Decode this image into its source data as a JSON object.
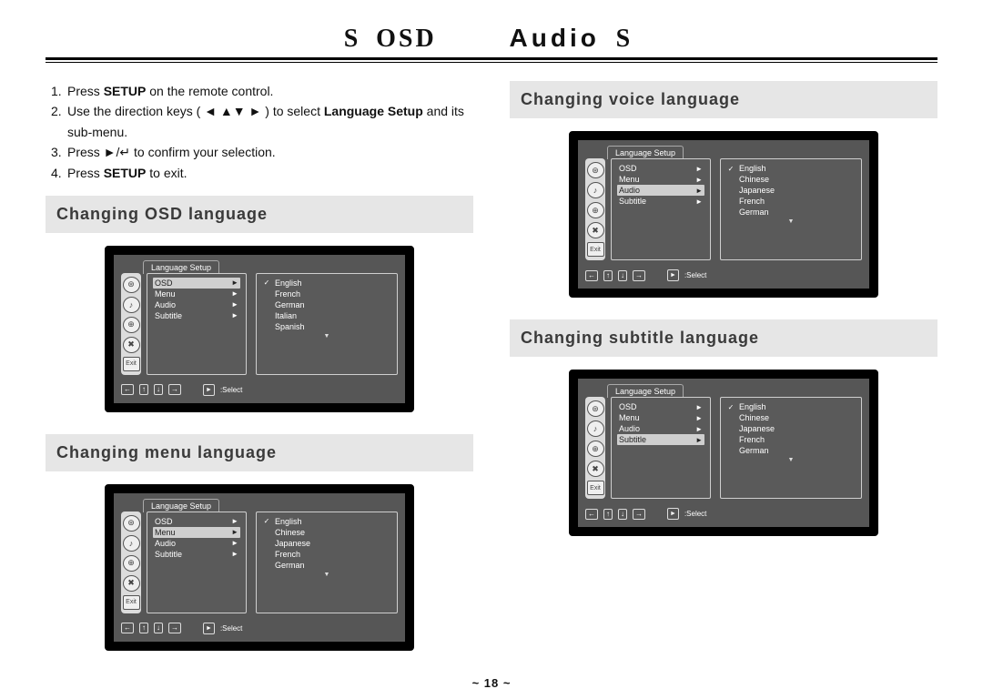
{
  "header": {
    "s1": "S",
    "osd": "OSD",
    "audio": "Audio",
    "s2": "S"
  },
  "steps": [
    {
      "n": "1.",
      "pre": "Press ",
      "bold1": "SETUP",
      "post": " on the remote control."
    },
    {
      "n": "2.",
      "pre": "Use the direction keys ( ◄ ▲▼ ► ) to select ",
      "bold1": "Language Setup",
      "post": " and its sub-menu."
    },
    {
      "n": "3.",
      "pre": "Press ►/↵ to confirm your selection.",
      "bold1": "",
      "post": ""
    },
    {
      "n": "4.",
      "pre": "Press ",
      "bold1": "SETUP",
      "post": " to exit."
    }
  ],
  "sections": {
    "osd": "Changing OSD language",
    "menu": "Changing menu language",
    "voice": "Changing voice language",
    "subtitle": "Changing subtitle language"
  },
  "menuTab": "Language Setup",
  "menuItems": [
    "OSD",
    "Menu",
    "Audio",
    "Subtitle"
  ],
  "langsOSD": [
    "English",
    "French",
    "German",
    "Italian",
    "Spanish"
  ],
  "langsOther": [
    "English",
    "Chinese",
    "Japanese",
    "French",
    "German"
  ],
  "highlight": {
    "osd": 0,
    "menu": 1,
    "voice": 2,
    "subtitle": 3
  },
  "footer": {
    "btns": [
      "←",
      "↑",
      "↓",
      "→"
    ],
    "selectLabel": ":Select"
  },
  "pageNum": "~ 18 ~"
}
